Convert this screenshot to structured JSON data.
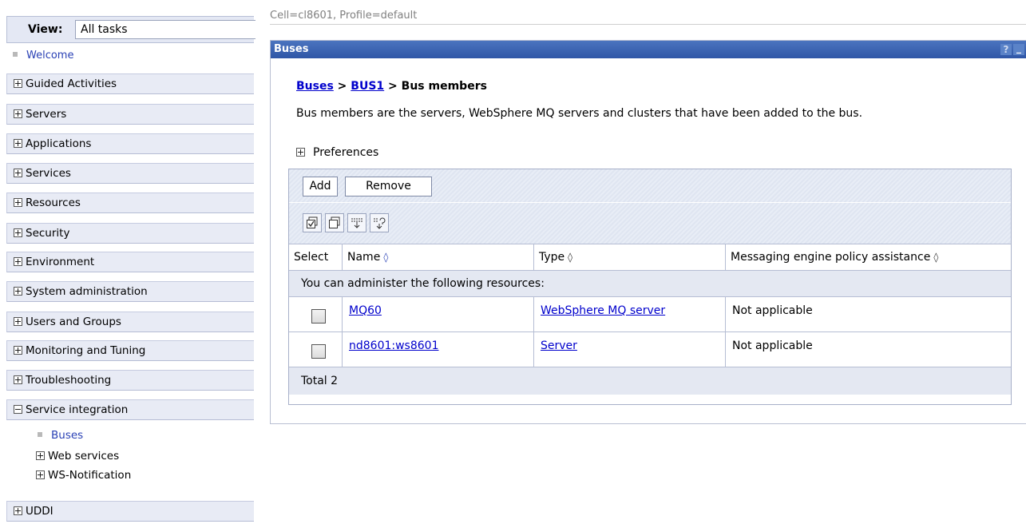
{
  "sidebar": {
    "view_label": "View:",
    "view_value": "All tasks",
    "welcome": "Welcome",
    "items": [
      {
        "label": "Guided Activities"
      },
      {
        "label": "Servers"
      },
      {
        "label": "Applications"
      },
      {
        "label": "Services"
      },
      {
        "label": "Resources"
      },
      {
        "label": "Security"
      },
      {
        "label": "Environment"
      },
      {
        "label": "System administration"
      },
      {
        "label": "Users and Groups"
      },
      {
        "label": "Monitoring and Tuning"
      },
      {
        "label": "Troubleshooting"
      },
      {
        "label": "Service integration"
      },
      {
        "label": "UDDI"
      }
    ],
    "service_integration_children": [
      {
        "label": "Buses"
      },
      {
        "label": "Web services"
      },
      {
        "label": "WS-Notification"
      }
    ]
  },
  "header": {
    "context": "Cell=cl8601, Profile=default"
  },
  "panel": {
    "title": "Buses",
    "help": "?",
    "minimize": "_",
    "breadcrumb": {
      "link1": "Buses",
      "sep1": " > ",
      "link2": "BUS1",
      "sep2": " > ",
      "current": "Bus members"
    },
    "description": "Bus members are the servers, WebSphere MQ servers and clusters that have been added to the bus.",
    "preferences": "Preferences"
  },
  "table": {
    "buttons": {
      "add": "Add",
      "remove": "Remove"
    },
    "icons": [
      "select-all-icon",
      "deselect-all-icon",
      "show-filter-icon",
      "clear-filter-icon"
    ],
    "columns": [
      "Select",
      "Name",
      "Type",
      "Messaging engine policy assistance"
    ],
    "sort_glyph": "◊",
    "section_label": "You can administer the following resources:",
    "rows": [
      {
        "name": "MQ60",
        "type": "WebSphere MQ server",
        "policy": "Not applicable"
      },
      {
        "name": "nd8601:ws8601",
        "type": "Server",
        "policy": "Not applicable"
      }
    ],
    "total": "Total 2"
  }
}
